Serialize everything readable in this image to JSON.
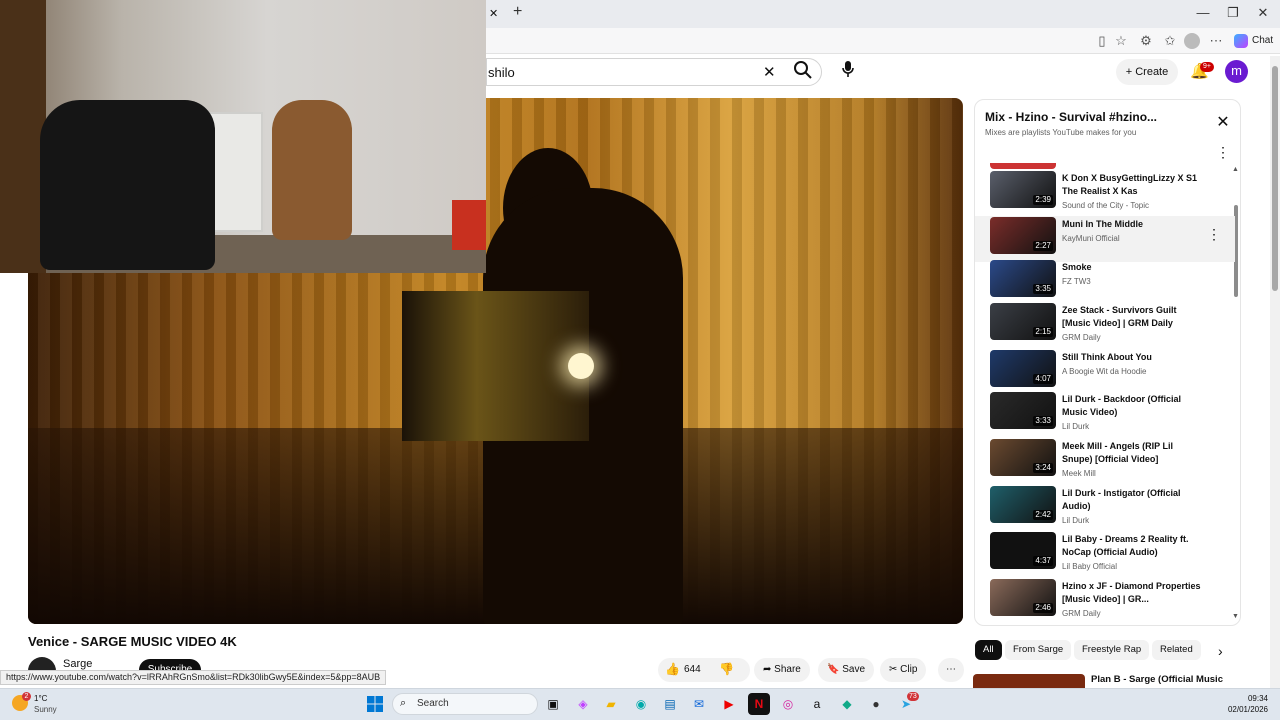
{
  "browser": {
    "tab_close": "✕",
    "new_tab": "+",
    "chat_label": "Chat",
    "window": {
      "minimize": "—",
      "restore": "❐",
      "close": "✕"
    }
  },
  "youtube_header": {
    "search_value": "shilo",
    "create_label": "Create",
    "notif_count": "9+",
    "avatar_letter": "m"
  },
  "video": {
    "title": "Venice - SARGE MUSIC VIDEO 4K",
    "channel": "Sarge",
    "subscribe_label": "Subscribe",
    "likes": "644",
    "share_label": "Share",
    "save_label": "Save",
    "clip_label": "Clip"
  },
  "status_url": "https://www.youtube.com/watch?v=lRRAhRGnSmo&list=RDk30libGwy5E&index=5&pp=8AUB",
  "playlist": {
    "title": "Mix - Hzino - Survival #hzino...",
    "subtitle": "Mixes are playlists YouTube makes for you",
    "items": [
      {
        "title": "K Don X BusyGettingLizzy X S1 The Realist X Kas",
        "channel": "Sound of the City - Topic",
        "duration": "2:39",
        "color": "#5a5f6b"
      },
      {
        "title": "Muni In The Middle",
        "channel": "KayMuni Official",
        "duration": "2:27",
        "color": "#7b2d2a"
      },
      {
        "title": "Smoke",
        "channel": "FZ TW3",
        "duration": "3:35",
        "color": "#2b4a8a"
      },
      {
        "title": "Zee Stack - Survivors Guilt [Music Video] | GRM Daily",
        "channel": "GRM Daily",
        "duration": "2:15",
        "color": "#3b3f46"
      },
      {
        "title": "Still Think About You",
        "channel": "A Boogie Wit da Hoodie",
        "duration": "4:07",
        "color": "#1f3a6a"
      },
      {
        "title": "Lil Durk - Backdoor (Official Music Video)",
        "channel": "Lil Durk",
        "duration": "3:33",
        "color": "#2a2a2a"
      },
      {
        "title": "Meek Mill - Angels (RIP Lil Snupe) [Official Video]",
        "channel": "Meek Mill",
        "duration": "3:24",
        "color": "#6b4a30"
      },
      {
        "title": "Lil Durk - Instigator (Official Audio)",
        "channel": "Lil Durk",
        "duration": "2:42",
        "color": "#1f5f6a"
      },
      {
        "title": "Lil Baby - Dreams 2 Reality ft. NoCap (Official Audio)",
        "channel": "Lil Baby Official",
        "duration": "4:37",
        "color": "#111111"
      },
      {
        "title": "Hzino x JF - Diamond Properties [Music Video] | GR...",
        "channel": "GRM Daily",
        "duration": "2:46",
        "color": "#8a6a5a"
      }
    ]
  },
  "chips": [
    "All",
    "From Sarge",
    "Freestyle Rap",
    "Related"
  ],
  "next_video_title": "Plan B - Sarge (Official Music",
  "taskbar": {
    "weather_temp": "1°C",
    "weather_desc": "Sunny",
    "weather_badge": "2",
    "search_placeholder": "Search",
    "time": "09:34",
    "date": "02/01/2026",
    "app_badge": "73"
  },
  "colors": {
    "yt_red": "#ff0000",
    "avatar": "#6a1bd1",
    "chip_active": "#0f0f0f"
  }
}
